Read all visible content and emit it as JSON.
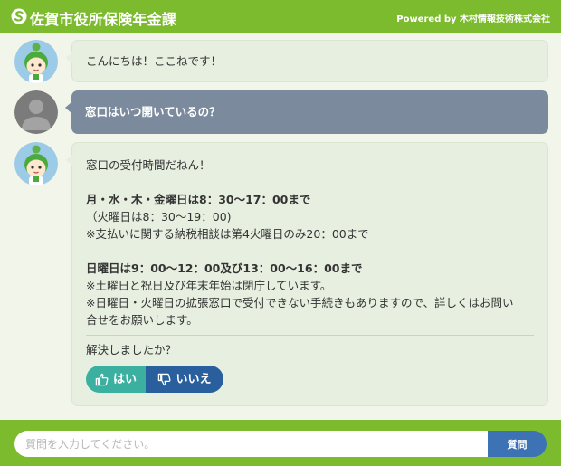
{
  "header": {
    "title": "佐賀市役所保険年金課",
    "powered_by": "Powered by 木村情報技術株式会社"
  },
  "messages": [
    {
      "sender": "bot",
      "text": "こんにちは！ここねです！"
    },
    {
      "sender": "user",
      "text": "窓口はいつ開いているの？"
    },
    {
      "sender": "bot",
      "lines": [
        "窓口の受付時間だねん！",
        "月・水・木・金曜日は8：30～17：00まで",
        "（火曜日は8：30～19：00)",
        "※支払いに関する納税相談は第4火曜日のみ20：00まで",
        "日曜日は9：00～12：00及び13：00～16：00まで",
        "※土曜日と祝日及び年末年始は閉庁しています。",
        "※日曜日・火曜日の拡張窓口で受付できない手続きもありますので、詳しくはお問い",
        "合せをお願いします。"
      ],
      "feedback_question": "解決しましたか？",
      "feedback_yes": "はい",
      "feedback_no": "いいえ"
    }
  ],
  "input": {
    "placeholder": "質問を入力してください。",
    "value": "",
    "send_label": "質問"
  },
  "colors": {
    "brand_green": "#7cbb2e",
    "user_bubble": "#7b8a9c",
    "bot_bubble": "#e6efe0",
    "yes_button": "#3bb0a0",
    "no_button": "#2a5f9e",
    "send_button": "#3d73b5"
  },
  "icons": {
    "logo": "city-logo-icon",
    "bot_avatar": "mascot-avatar",
    "user_avatar": "user-avatar",
    "yes": "thumbs-up-icon",
    "no": "thumbs-down-icon"
  }
}
